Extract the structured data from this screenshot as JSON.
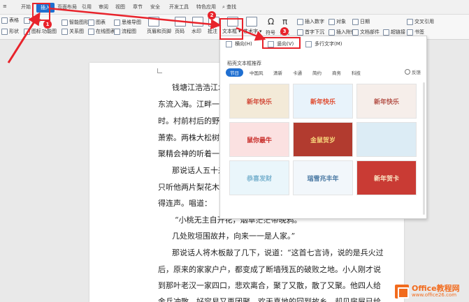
{
  "tabs": [
    "开始",
    "插入",
    "页面布局",
    "引用",
    "审阅",
    "视图",
    "章节",
    "安全",
    "开发工具",
    "特色应用"
  ],
  "active_tab": "插入",
  "search_label": "查找",
  "toolbar": {
    "row1": [
      "表格",
      "图片",
      "形状",
      "图标",
      "功能图",
      "智能图形",
      "图表",
      "思维导图",
      "流程图",
      "页眉和页脚",
      "页码",
      "水印",
      "批注",
      "文本框",
      "艺术字",
      "符号",
      "公式",
      "插入数字",
      "对象",
      "首字下沉",
      "插入附件",
      "日期",
      "文档部件",
      "超链接",
      "交叉引用",
      "书签"
    ],
    "textbox_label": "文本框",
    "arttext_label": "艺术字"
  },
  "dropdown": {
    "options": [
      "横向(H)",
      "竖向(V)",
      "多行文字(M)"
    ],
    "section_title": "稻壳文本框推荐",
    "categories": [
      "节日",
      "中国风",
      "清新",
      "卡通",
      "简约",
      "商务",
      "科技"
    ],
    "feedback": "反馈",
    "thumbnails": [
      {
        "title": "新年快乐",
        "bg": "#f3ead8",
        "fg": "#d24b3a"
      },
      {
        "title": "新年快乐",
        "bg": "#e8f3fb",
        "fg": "#e04b2f"
      },
      {
        "title": "新年快乐",
        "bg": "#f6eeea",
        "fg": "#b5534a"
      },
      {
        "title": "鼠你最牛",
        "bg": "#fbe1e1",
        "fg": "#c9302c"
      },
      {
        "title": "金鼠贺岁",
        "bg": "#b23b2f",
        "fg": "#f6d27a"
      },
      {
        "title": "",
        "bg": "#dcecf5",
        "fg": "#6a93b3"
      },
      {
        "title": "恭喜发财",
        "bg": "#eaf6fb",
        "fg": "#7ab3cf"
      },
      {
        "title": "瑞雪兆丰年",
        "bg": "#f2f7fb",
        "fg": "#4a79a3"
      },
      {
        "title": "新年贺卡",
        "bg": "#c93b34",
        "fg": "#fbe7c5"
      }
    ]
  },
  "badges": [
    "1",
    "2",
    "3"
  ],
  "document": {
    "lines": [
      "钱塘江浩浩江水",
      "东流入海。江畔一排",
      "时。村前村后的野草",
      "萧索。两株大松树下",
      "聚精会神的听着一个",
      "那说话人五十来",
      "只听他两片梨花木板",
      "得连声。唱道：",
      "“小桃无主自开花，烟草茫茫带晚鸦。",
      "几处败垣围故井，向来一一是人家。”",
      "那说话人将木板敲了几下，说道：“这首七言诗，说的是兵火过",
      "后，原来的家家户户，都变成了断墙残瓦的破败之地。小人刚才说",
      "到那叶老汉一家四口，悲欢离合，聚了又散，散了又聚。他四人给",
      "金兵冲散，好容易又再团聚，欢天喜地的回到故乡，却见房屋已给"
    ]
  },
  "watermark": {
    "title": "Office教程网",
    "url": "www.office26.com"
  },
  "colors": {
    "accent": "#1f6fd1",
    "annotation": "#e8232b",
    "watermark": "#f26b1d"
  }
}
